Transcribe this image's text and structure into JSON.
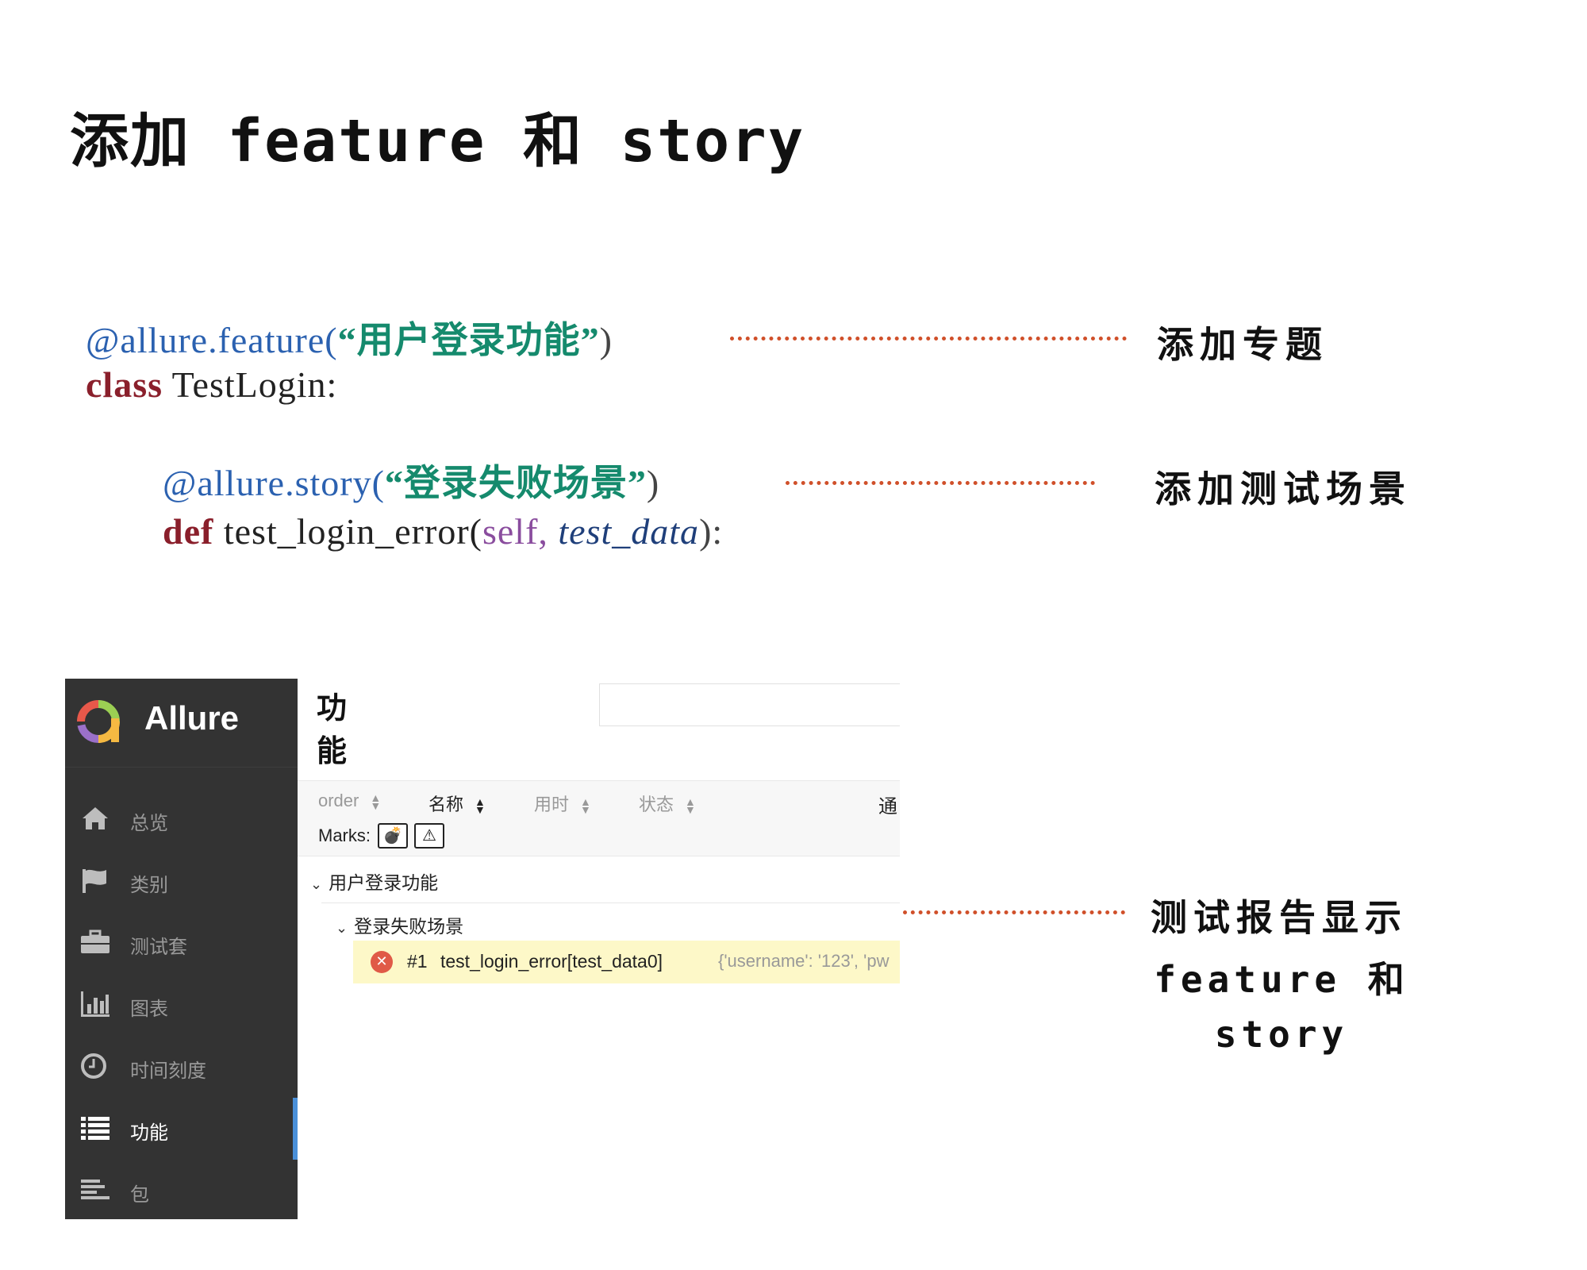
{
  "title": "添加 feature 和 story",
  "code": {
    "line1": {
      "decorator": "@allure.feature(",
      "string": "“用户登录功能”",
      "close": ")"
    },
    "line2": {
      "keyword": "class",
      "name": " TestLogin:"
    },
    "line3": {
      "decorator": "@allure.story(",
      "string": "“登录失败场景”",
      "close": ")"
    },
    "line4": {
      "keyword": "def",
      "name": " test_login_error(",
      "self": "self,",
      "param": " test_data",
      "close": "):"
    }
  },
  "annotations": {
    "feature_note": "添加专题",
    "story_note": "添加测试场景",
    "report_note_line1": "测试报告显示",
    "report_note_line2": "feature 和",
    "report_note_line3": "story"
  },
  "colors": {
    "dots": "#d0502a",
    "sidebar": "#333333",
    "active_bar": "#4a90d9",
    "case_highlight": "#fdf8c8",
    "fail": "#e05a47"
  },
  "allure": {
    "brand": "Allure",
    "nav": [
      {
        "label": "总览",
        "icon": "home-icon"
      },
      {
        "label": "类别",
        "icon": "flag-icon"
      },
      {
        "label": "测试套",
        "icon": "briefcase-icon"
      },
      {
        "label": "图表",
        "icon": "bar-chart-icon"
      },
      {
        "label": "时间刻度",
        "icon": "clock-icon"
      },
      {
        "label": "功能",
        "icon": "list-icon",
        "active": true
      },
      {
        "label": "包",
        "icon": "align-left-icon"
      }
    ],
    "page_title": "功能",
    "toolbar": {
      "sort": [
        "order",
        "名称",
        "用时",
        "状态"
      ],
      "right": "通",
      "marks_label": "Marks:"
    },
    "tree": {
      "feature": "用户登录功能",
      "story": "登录失败场景",
      "case": {
        "num": "#1",
        "name": "test_login_error[test_data0]",
        "params": "{'username': '123', 'pw"
      }
    }
  }
}
